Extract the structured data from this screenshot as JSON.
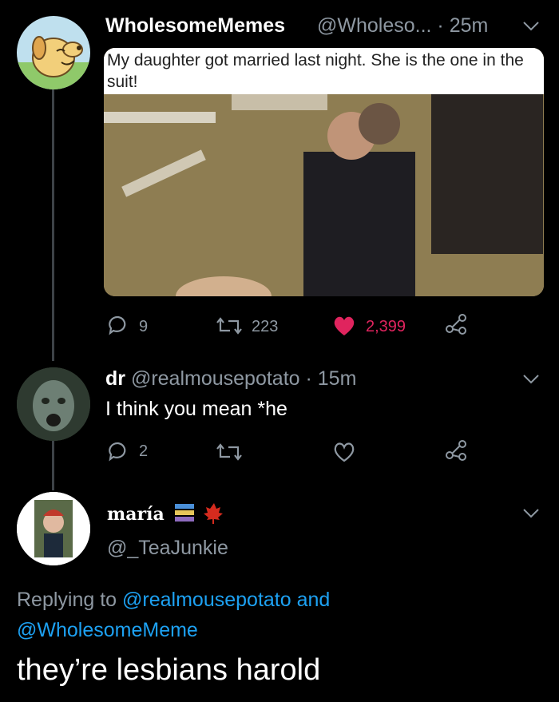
{
  "tweet1": {
    "display_name": "WholesomeMemes",
    "handle_time": "@Wholeso... · 25m",
    "caption": "My daughter got married last night. She is the one in the suit!",
    "replies": "9",
    "retweets": "223",
    "likes": "2,399",
    "like_color": "#e0245e"
  },
  "tweet2": {
    "display_name": "dr",
    "handle_time": "@realmousepotato · 15m",
    "text": "I think you mean *he",
    "replies": "2"
  },
  "tweet3": {
    "display_name": "maría",
    "handle": "@_TeaJunkie",
    "replying_prefix": "Replying to",
    "replying_to_1": "@realmousepotato",
    "replying_and": "and",
    "replying_to_2": "@WholesomeMeme",
    "text": "they’re lesbians harold"
  },
  "colors": {
    "background": "#000000",
    "link": "#1da1f2",
    "secondary_text": "#8e98a2"
  }
}
